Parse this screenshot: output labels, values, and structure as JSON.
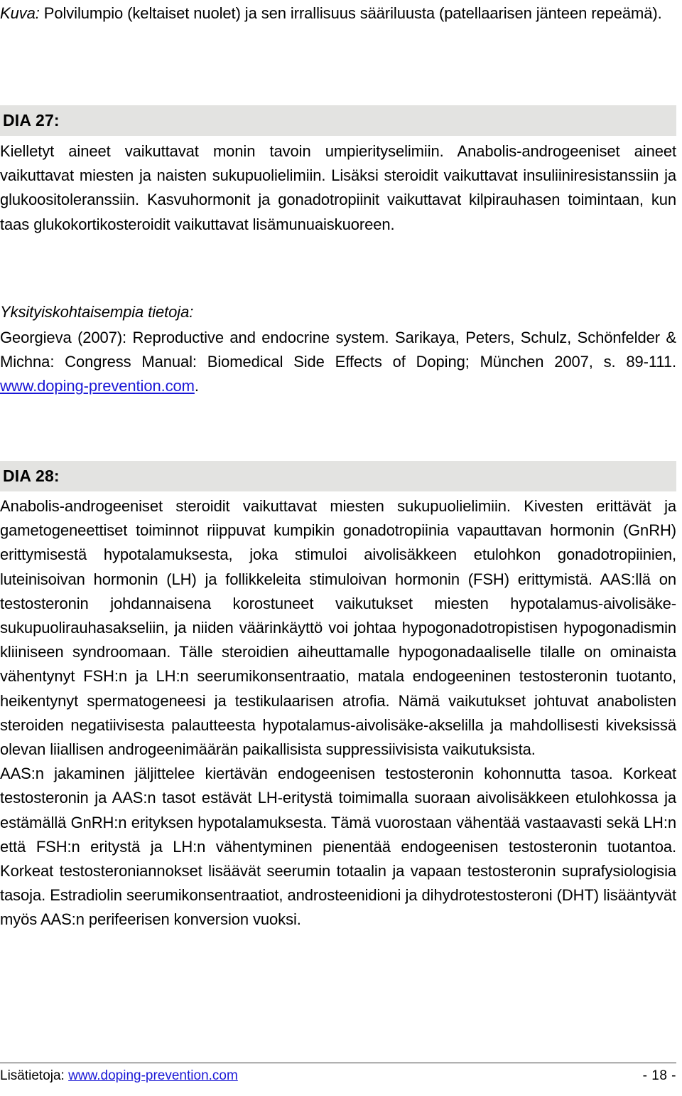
{
  "document": {
    "language": "fi",
    "page_number_label": "- 18 -"
  },
  "caption": {
    "label": "Kuva:",
    "text": "Polvilumpio (keltaiset nuolet) ja sen irrallisuus sääriluusta (patellaarisen jänteen repeämä)."
  },
  "sections": [
    {
      "heading": "DIA 27:",
      "paragraphs": [
        "Kielletyt aineet vaikuttavat monin tavoin umpierityselimiin. Anabolis-androgeeniset aineet vaikuttavat miesten ja naisten sukupuolielimiin. Lisäksi steroidit vaikuttavat insuliiniresistanssiin ja glukoositoleranssiin. Kasvuhormonit ja gonadotropiinit vaikuttavat kilpirauhasen toimintaan, kun taas glukokortikosteroidit vaikuttavat lisämunuaiskuoreen."
      ],
      "details_heading": "Yksityiskohtaisempia tietoja:",
      "reference": {
        "text_before": "Georgieva (2007): Reproductive and endocrine system. Sarikaya, Peters, Schulz, Schönfelder & Michna: Congress Manual: Biomedical Side Effects of Doping; München 2007, s. 89-111. ",
        "link": "www.doping-prevention.com",
        "text_after": "."
      }
    },
    {
      "heading": "DIA 28:",
      "paragraphs": [
        "Anabolis-androgeeniset steroidit vaikuttavat miesten sukupuolielimiin. Kivesten erittävät ja gametogeneettiset toiminnot riippuvat kumpikin gonadotropiinia vapauttavan hormonin (GnRH) erittymisestä hypotalamuksesta, joka stimuloi aivolisäkkeen etulohkon gonadotropiinien, luteinisoivan hormonin (LH) ja follikkeleita stimuloivan hormonin (FSH) erittymistä. AAS:llä on testosteronin johdannaisena korostuneet vaikutukset miesten hypotalamus-aivolisäke-sukupuolirauhasakseliin, ja niiden väärinkäyttö voi johtaa hypogonadotropistisen hypogonadismin kliiniseen syndroomaan. Tälle steroidien aiheuttamalle hypogonadaaliselle tilalle on ominaista vähentynyt FSH:n ja LH:n seerumikonsentraatio, matala endogeeninen testosteronin tuotanto, heikentynyt spermatogeneesi ja testikulaarisen atrofia. Nämä vaikutukset johtuvat anabolisten steroiden negatiivisesta palautteesta hypotalamus-aivolisäke-akselilla ja mahdollisesti kiveksissä olevan liiallisen androgeenimäärän paikallisista suppressiivisista vaikutuksista.",
        "AAS:n jakaminen jäljittelee kiertävän endogeenisen testosteronin kohonnutta tasoa. Korkeat testosteronin ja AAS:n tasot estävät LH-eritystä toimimalla suoraan aivolisäkkeen etulohkossa ja estämällä GnRH:n erityksen hypotalamuksesta. Tämä vuorostaan vähentää vastaavasti sekä LH:n että FSH:n eritystä ja LH:n vähentyminen pienentää endogeenisen testosteronin tuotantoa. Korkeat testosteroniannokset lisäävät seerumin totaalin ja vapaan testosteronin suprafysiologisia tasoja. Estradiolin seerumikonsentraatiot, androsteenidioni ja dihydrotestosteroni (DHT) lisääntyvät myös AAS:n perifeerisen konversion vuoksi."
      ]
    }
  ],
  "footer": {
    "prefix": "Lisätietoja:",
    "link": "www.doping-prevention.com",
    "page": "- 18 -"
  },
  "colors": {
    "link": "#1a17d6",
    "heading_band": "#e3e3e1",
    "text": "#000000",
    "rule": "#3a3a3a"
  }
}
